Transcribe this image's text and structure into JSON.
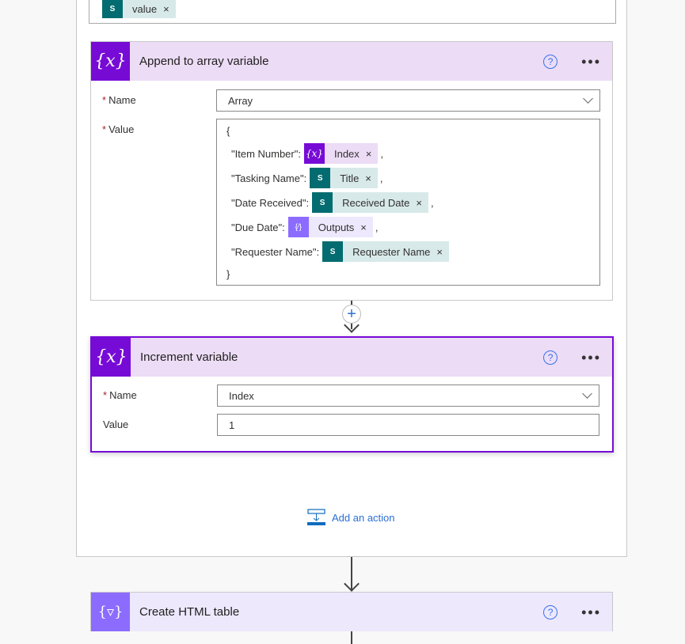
{
  "previous": {
    "token_label": "value"
  },
  "append": {
    "title": "Append to array variable",
    "name_label": "Name",
    "name_value": "Array",
    "value_label": "Value",
    "open_brace": "{",
    "close_brace": "}",
    "lines": [
      {
        "key": "\"Item Number\":",
        "token": "Index",
        "kind": "variable",
        "comma": ","
      },
      {
        "key": "\"Tasking Name\":",
        "token": "Title",
        "kind": "sharepoint",
        "comma": ","
      },
      {
        "key": "\"Date Received\":",
        "token": "Received Date",
        "kind": "sharepoint",
        "comma": ","
      },
      {
        "key": "\"Due Date\":",
        "token": "Outputs",
        "kind": "expression",
        "comma": ","
      },
      {
        "key": "\"Requester Name\":",
        "token": "Requester Name",
        "kind": "sharepoint",
        "comma": ""
      }
    ]
  },
  "increment": {
    "title": "Increment variable",
    "name_label": "Name",
    "name_value": "Index",
    "value_label": "Value",
    "value_value": "1"
  },
  "add_action": {
    "label": "Add an action"
  },
  "html_table": {
    "title": "Create HTML table"
  },
  "icons": {
    "help": "?",
    "more": "•••",
    "required": "*",
    "remove": "×",
    "plus": "+"
  },
  "colors": {
    "variable": "#770bd6",
    "sharepoint": "#036c70",
    "expression": "#8c6cff",
    "link": "#0f6cbd"
  }
}
